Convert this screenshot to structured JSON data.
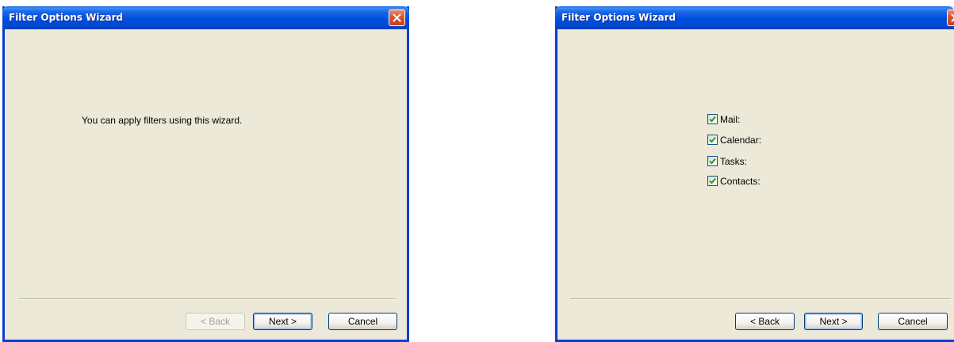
{
  "dialogs": [
    {
      "title": "Filter Options Wizard",
      "intro_text": "You can apply filters using this wizard.",
      "buttons": {
        "back": "< Back",
        "next": "Next >",
        "cancel": "Cancel"
      },
      "back_enabled": false
    },
    {
      "title": "Filter Options Wizard",
      "filters": [
        {
          "label": "Mail:",
          "checked": true
        },
        {
          "label": "Calendar:",
          "checked": true
        },
        {
          "label": "Tasks:",
          "checked": true
        },
        {
          "label": "Contacts:",
          "checked": true
        }
      ],
      "buttons": {
        "back": "< Back",
        "next": "Next >",
        "cancel": "Cancel"
      },
      "back_enabled": true
    }
  ],
  "icons": {
    "close": "close-icon",
    "checkmark": "checkmark-icon"
  },
  "colors": {
    "titlebar": "#0050e0",
    "dialog_bg": "#ece9d8",
    "close_button": "#d6552f",
    "checkmark": "#21a121",
    "default_button_focus": "#98b8ea"
  }
}
